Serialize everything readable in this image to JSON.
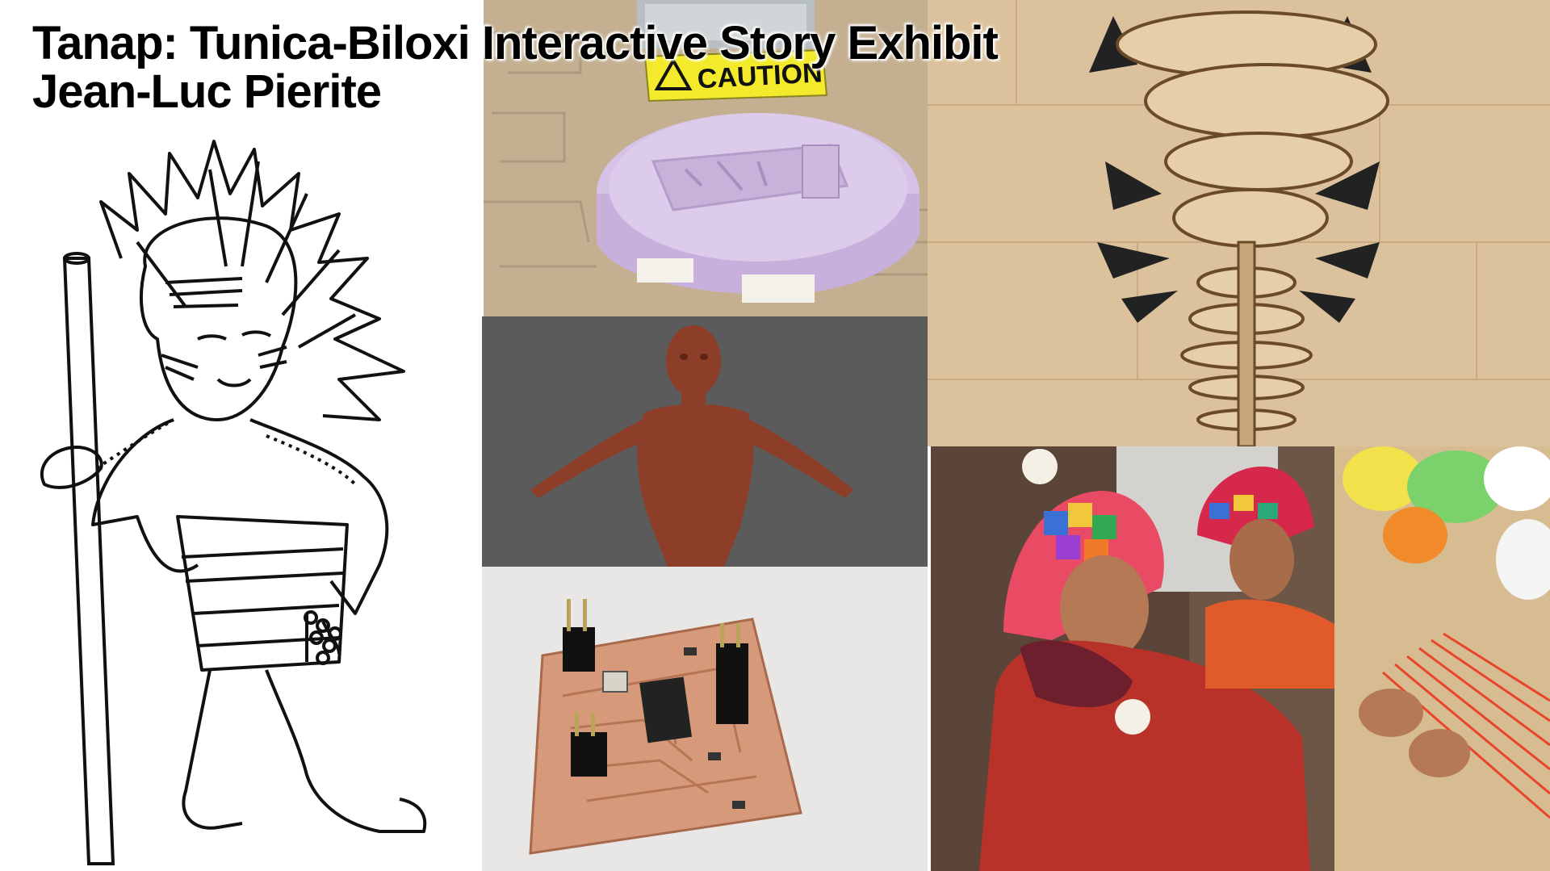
{
  "title": "Tanap: Tunica-Biloxi Interactive Story Exhibit",
  "author": "Jean-Luc Pierite",
  "photos": {
    "foam_sign_text": "CAUTION"
  },
  "colors": {
    "title_text": "#000000",
    "background": "#ffffff",
    "foam": "#d6c2e6",
    "wood": "#dcc29c",
    "clay": "#8c3e28",
    "pcb_copper": "#d69a7a",
    "caution_yellow": "#f2ea2a",
    "sweater_red": "#b8322a"
  }
}
